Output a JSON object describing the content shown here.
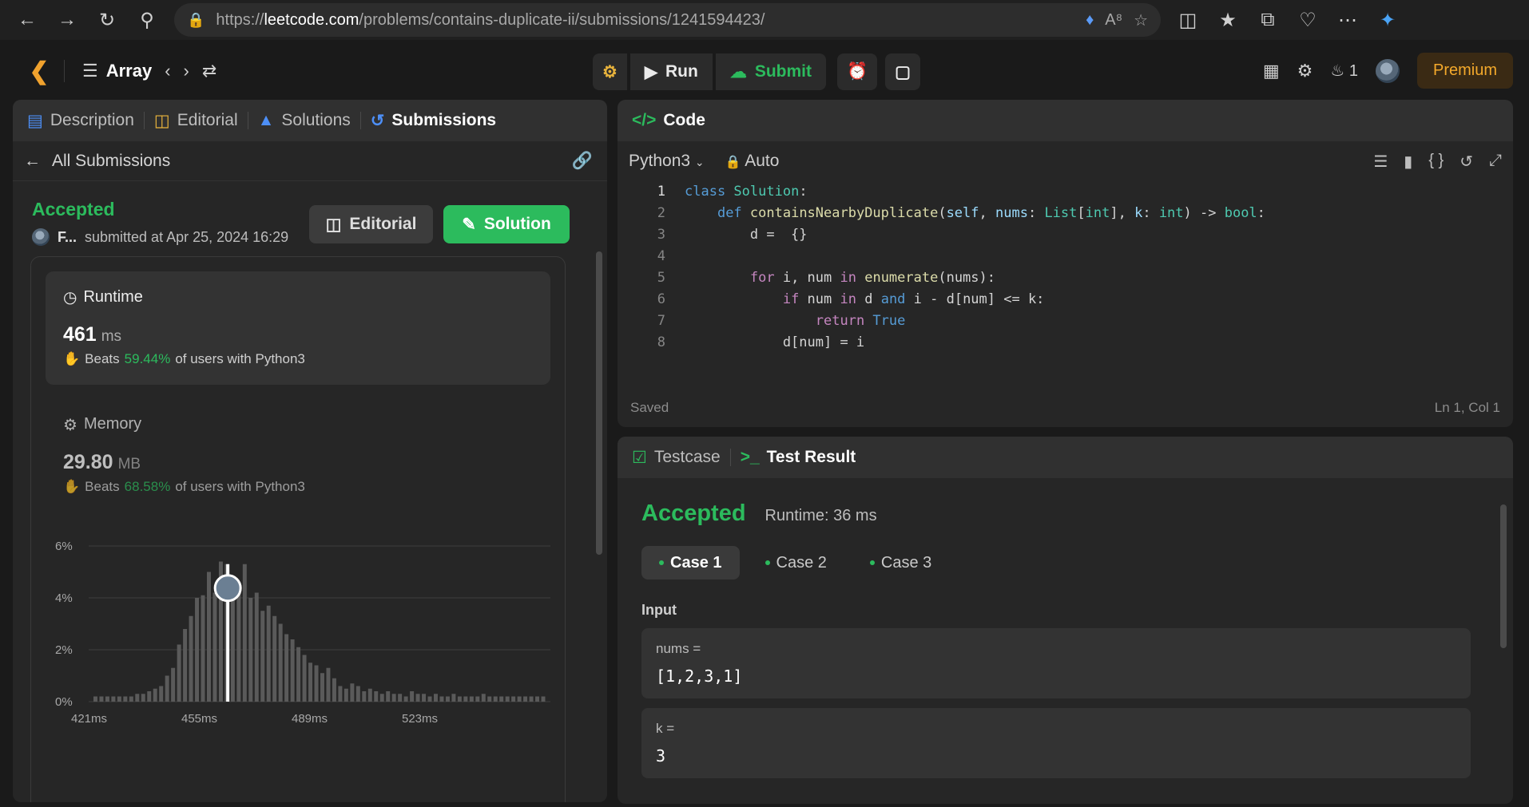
{
  "browser": {
    "url_prefix": "https://",
    "url_host": "leetcode.com",
    "url_path": "/problems/contains-duplicate-ii/submissions/1241594423/"
  },
  "topnav": {
    "problem_list": "Array",
    "run_label": "Run",
    "submit_label": "Submit",
    "streak_count": "1",
    "premium_label": "Premium"
  },
  "left_panel": {
    "tabs": [
      {
        "label": "Description",
        "icon": "document-icon"
      },
      {
        "label": "Editorial",
        "icon": "book-icon"
      },
      {
        "label": "Solutions",
        "icon": "flask-icon"
      },
      {
        "label": "Submissions",
        "icon": "history-icon"
      }
    ],
    "back_label": "All Submissions",
    "status": "Accepted",
    "username": "F...",
    "submitted_at": "submitted at Apr 25, 2024 16:29",
    "editorial_button": "Editorial",
    "solution_button": "Solution",
    "runtime": {
      "label": "Runtime",
      "value": "461",
      "unit": "ms",
      "beats_prefix": "Beats",
      "beats_pct": "59.44%",
      "beats_suffix": "of users with Python3"
    },
    "memory": {
      "label": "Memory",
      "value": "29.80",
      "unit": "MB",
      "beats_prefix": "Beats",
      "beats_pct": "68.58%",
      "beats_suffix": "of users with Python3"
    }
  },
  "chart_data": {
    "type": "bar",
    "ylim": [
      0,
      6
    ],
    "y_ticks": [
      "6%",
      "4%",
      "2%",
      "0%"
    ],
    "x_ticks": [
      "421ms",
      "455ms",
      "489ms",
      "523ms"
    ],
    "values": [
      0.2,
      0.2,
      0.2,
      0.2,
      0.2,
      0.2,
      0.2,
      0.3,
      0.3,
      0.4,
      0.5,
      0.6,
      1.0,
      1.3,
      2.2,
      2.8,
      3.3,
      4.0,
      4.1,
      5.0,
      4.2,
      5.4,
      5.3,
      4.6,
      4.4,
      5.3,
      4.0,
      4.2,
      3.5,
      3.7,
      3.3,
      3.0,
      2.6,
      2.4,
      2.1,
      1.8,
      1.5,
      1.4,
      1.1,
      1.3,
      0.9,
      0.6,
      0.5,
      0.7,
      0.6,
      0.4,
      0.5,
      0.4,
      0.3,
      0.4,
      0.3,
      0.3,
      0.2,
      0.4,
      0.3,
      0.3,
      0.2,
      0.3,
      0.2,
      0.2,
      0.3,
      0.2,
      0.2,
      0.2,
      0.2,
      0.3,
      0.2,
      0.2,
      0.2,
      0.2,
      0.2,
      0.2,
      0.2,
      0.2,
      0.2,
      0.2
    ],
    "highlight_index": 22
  },
  "code_panel": {
    "title": "Code",
    "language": "Python3",
    "mode": "Auto",
    "saved": "Saved",
    "position": "Ln 1, Col 1"
  },
  "test_panel": {
    "tab_testcase": "Testcase",
    "tab_result": "Test Result",
    "status": "Accepted",
    "runtime": "Runtime: 36 ms",
    "cases": [
      "Case 1",
      "Case 2",
      "Case 3"
    ],
    "input_label": "Input",
    "inputs": [
      {
        "name": "nums =",
        "value": "[1,2,3,1]"
      },
      {
        "name": "k =",
        "value": "3"
      }
    ]
  }
}
